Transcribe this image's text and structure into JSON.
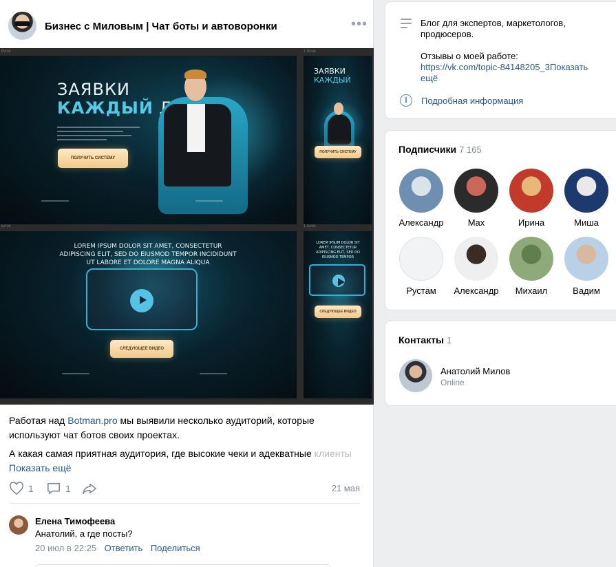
{
  "post": {
    "group_name": "Бизнес с Миловым | Чат боты и автоворонки",
    "image_labels": {
      "frame1": "Блок",
      "frame2": "1 блок",
      "frame3": "Блок",
      "frame4": "1 блок"
    },
    "image_content": {
      "hero_line1": "ЗАЯВКИ",
      "hero_line2_highlight": "КАЖДЫЙ",
      "hero_line2_rest": "ДЕНЬ",
      "cta_primary": "ПОЛУЧИТЬ СИСТЕМУ",
      "lorem": "LOREM IPSUM DOLOR SIT AMET, CONSECTETUR ADIPISCING ELIT, SED DO EIUSMOD TEMPOR INCIDIDUNT UT LABORE ET DOLORE MAGNA ALIQUA",
      "lorem_mobile": "LOREM IPSUM DOLOR SIT AMET, CONSECTETUR ADIPISCING ELIT, SED DO EIUSMOD TEMPOR",
      "cta_next_video": "СЛЕДУЮЩЕЕ ВИДЕО"
    },
    "text_p1_before_link": "Работая над ",
    "text_p1_link": "Botman.pro",
    "text_p1_after_link": " мы выявили несколько аудиторий, которые используют чат ботов своих проектах.",
    "text_p2_main": "А какая самая приятная аудитория, где высокие чеки и адекватные ",
    "text_p2_faded": "клиенты",
    "show_more": "Показать ещё",
    "likes": "1",
    "comments": "1",
    "date": "21 мая"
  },
  "comment": {
    "author": "Елена Тимофеева",
    "text": "Анатолий, а где посты?",
    "time": "20 июл в 22:25",
    "reply": "Ответить",
    "share": "Поделиться"
  },
  "info": {
    "line1": "Блог для экспертов, маркетологов, продюсеров.",
    "line2": "Отзывы о моей работе:",
    "link": "https://vk.com/topic-84148205_3",
    "show_more": "Показать ещё",
    "details": "Подробная информация"
  },
  "subscribers": {
    "title": "Подписчики",
    "count": "7 165",
    "items": [
      {
        "name": "Александр",
        "colors": [
          "#6f8fb0",
          "#d8e4ea"
        ]
      },
      {
        "name": "Max",
        "colors": [
          "#2b2b2b",
          "#c9685a"
        ]
      },
      {
        "name": "Ирина",
        "colors": [
          "#c23a2a",
          "#e8b77a"
        ]
      },
      {
        "name": "Миша",
        "colors": [
          "#1d3a6e",
          "#e9e9e9"
        ]
      },
      {
        "name": "Рустам",
        "colors": [
          "#f2f3f5",
          "#f2f3f5"
        ]
      },
      {
        "name": "Александр",
        "colors": [
          "#efefef",
          "#3a2c25"
        ]
      },
      {
        "name": "Михаил",
        "colors": [
          "#8faa7a",
          "#5f7f4f"
        ]
      },
      {
        "name": "Вадим",
        "colors": [
          "#b9d1e6",
          "#d9b8a0"
        ]
      }
    ]
  },
  "contacts": {
    "title": "Контакты",
    "count": "1",
    "name": "Анатолий Милов",
    "status": "Online"
  }
}
